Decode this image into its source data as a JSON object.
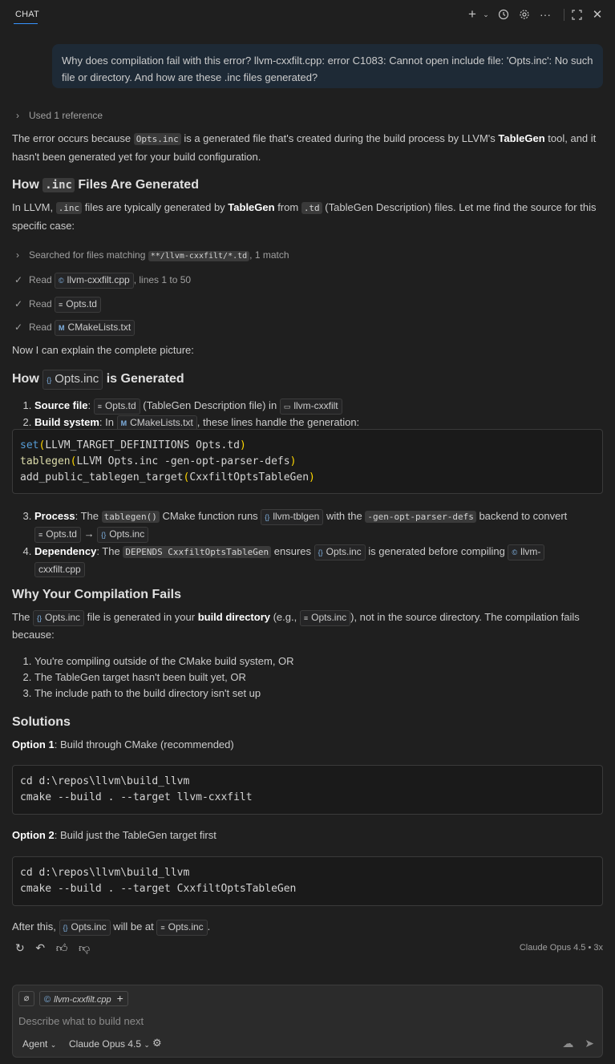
{
  "header": {
    "tab_label": "CHAT",
    "icons": [
      "plus-icon",
      "chevron-down-icon",
      "history-icon",
      "gear-icon",
      "more-icon",
      "maximize-icon",
      "close-icon"
    ]
  },
  "user_message": "Why does compilation fail with this error? llvm-cxxfilt.cpp: error C1083: Cannot open include file: 'Opts.inc': No such file or directory. And how are these .inc files generated?",
  "used_reference": "Used 1 reference",
  "intro": {
    "p1": "The error occurs because ",
    "code1": "Opts.inc",
    "p2": " is a generated file that's created during the build process by LLVM's ",
    "b1": "TableGen",
    "p3": " tool, and it hasn't been generated yet for your build configuration."
  },
  "h_how_inc": {
    "pre": "How ",
    "code": ".inc",
    "post": " Files Are Generated"
  },
  "how_inc_text": {
    "p1": "In LLVM, ",
    "code1": ".inc",
    "p2": " files are typically generated by ",
    "b1": "TableGen",
    "p3": " from ",
    "code2": ".td",
    "p4": " (TableGen Description) files. Let me find the source for this specific case:"
  },
  "search": {
    "pre": "Searched for files matching ",
    "code": "**/llvm-cxxfilt/*.td",
    "post": ", 1 match"
  },
  "reads": [
    {
      "label": "Read",
      "file": "llvm-cxxfilt.cpp",
      "suffix": ", lines 1 to 50"
    },
    {
      "label": "Read",
      "file": "Opts.td",
      "suffix": ""
    },
    {
      "label": "Read",
      "file": "CMakeLists.txt",
      "suffix": ""
    }
  ],
  "now_explain": "Now I can explain the complete picture:",
  "h_how_opts": {
    "pre": "How ",
    "pill": "Opts.inc",
    "post": " is Generated"
  },
  "steps1": {
    "s1_b": "Source file",
    "s1_pill": "Opts.td",
    "s1_mid": " (TableGen Description file) in ",
    "s1_folder": "llvm-cxxfilt",
    "s2_b": "Build system",
    "s2_pre": ": In ",
    "s2_pill": "CMakeLists.txt",
    "s2_post": ", these lines handle the generation:"
  },
  "code1": {
    "l1_fn": "set",
    "l1_args": "LLVM_TARGET_DEFINITIONS Opts.td",
    "l2_fn": "tablegen",
    "l2_args": "LLVM Opts.inc -gen-opt-parser-defs",
    "l3_fn": "add_public_tablegen_target",
    "l3_args": "CxxfiltOptsTableGen"
  },
  "steps2": {
    "s3_b": "Process",
    "s3_pre": ": The ",
    "s3_code1": "tablegen()",
    "s3_mid1": " CMake function runs ",
    "s3_pill1": "llvm-tblgen",
    "s3_mid2": " with the ",
    "s3_code2": "-gen-opt-parser-defs",
    "s3_mid3": " backend to convert ",
    "s3_pill2": "Opts.td",
    "s3_arrow": "→",
    "s3_pill3": "Opts.inc",
    "s4_b": "Dependency",
    "s4_pre": ": The ",
    "s4_code": "DEPENDS CxxfiltOptsTableGen",
    "s4_mid1": " ensures ",
    "s4_pill1": "Opts.inc",
    "s4_mid2": " is generated before compiling ",
    "s4_pill2a": "llvm-",
    "s4_pill2b": "cxxfilt.cpp"
  },
  "h_why": "Why Your Compilation Fails",
  "why_text": {
    "p1": "The ",
    "pill1": "Opts.inc",
    "p2": " file is generated in your ",
    "b1": "build directory",
    "p3": " (e.g., ",
    "pill2": "Opts.inc",
    "p4": "), not in the source directory. The compilation fails because:"
  },
  "reasons": [
    "You're compiling outside of the CMake build system, OR",
    "The TableGen target hasn't been built yet, OR",
    "The include path to the build directory isn't set up"
  ],
  "h_solutions": "Solutions",
  "opt1": {
    "b": "Option 1",
    "text": ": Build through CMake (recommended)"
  },
  "code2": [
    "cd d:\\repos\\llvm\\build_llvm",
    "cmake --build . --target llvm-cxxfilt"
  ],
  "opt2": {
    "b": "Option 2",
    "text": ": Build just the TableGen target first"
  },
  "code3": [
    "cd d:\\repos\\llvm\\build_llvm",
    "cmake --build . --target CxxfiltOptsTableGen"
  ],
  "after": {
    "p1": "After this, ",
    "pill1": "Opts.inc",
    "p2": " will be at ",
    "pill2": "Opts.inc",
    "p3": "."
  },
  "model_tag": "Claude Opus 4.5 • 3x",
  "input": {
    "file_chip": "llvm-cxxfilt.cpp",
    "placeholder": "Describe what to build next",
    "agent": "Agent",
    "model": "Claude Opus 4.5"
  }
}
